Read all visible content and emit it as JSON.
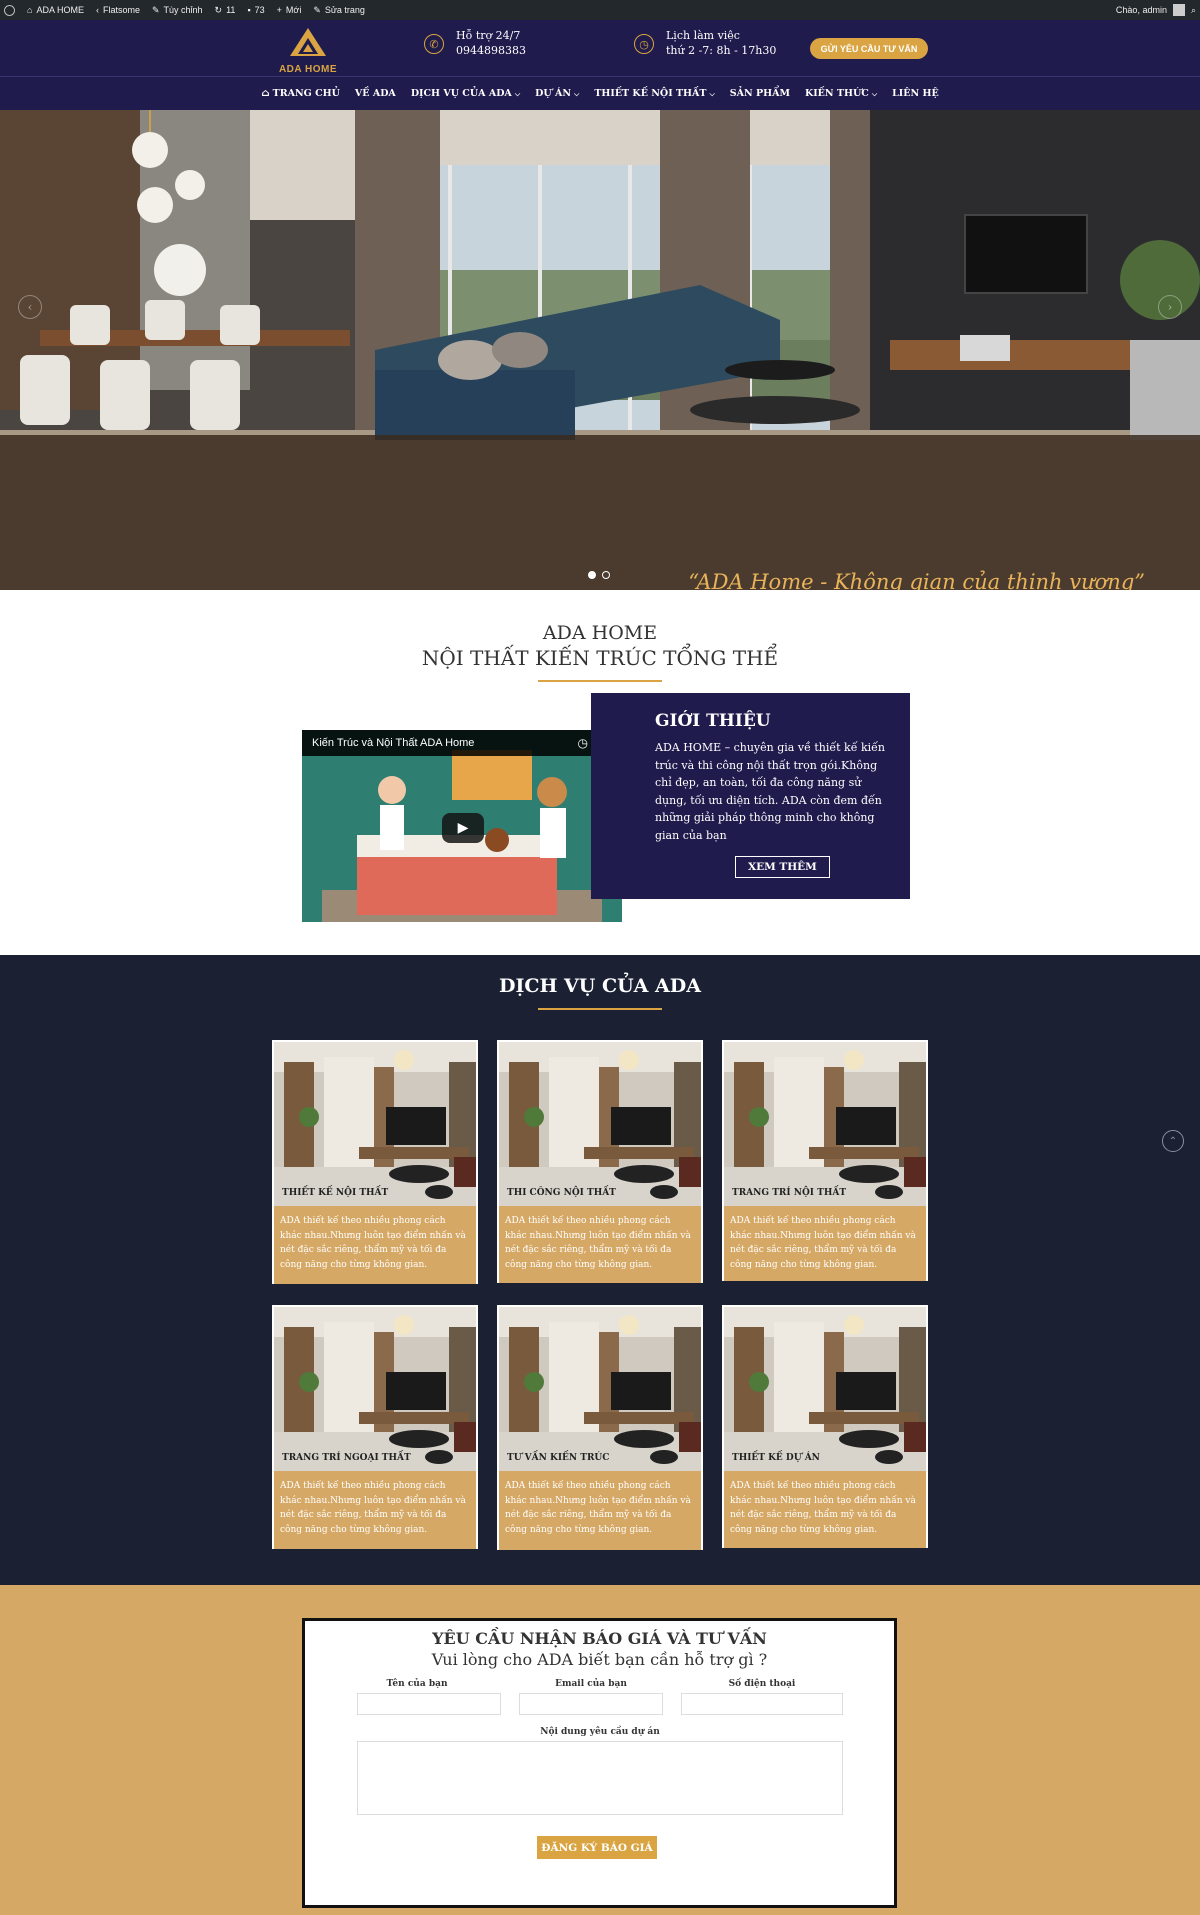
{
  "adminbar": {
    "site": "ADA HOME",
    "theme": "Flatsome",
    "customize": "Tùy chỉnh",
    "updates": "11",
    "comments": "73",
    "new": "Mới",
    "edit": "Sửa trang",
    "greeting": "Chào, admin"
  },
  "header": {
    "logo_text": "ADA HOME",
    "support_label": "Hỗ trợ 24/7",
    "support_phone": "0944898383",
    "hours_label": "Lịch làm việc",
    "hours_value": "thứ 2 -7: 8h - 17h30",
    "cta": "GỬI YÊU CẦU TƯ VẤN",
    "accent": "#d9a441",
    "bg": "#1f1b4d"
  },
  "nav": {
    "items": [
      {
        "label": "TRANG CHỦ",
        "dropdown": false
      },
      {
        "label": "VỀ ADA",
        "dropdown": false
      },
      {
        "label": "DỊCH VỤ CỦA ADA",
        "dropdown": true
      },
      {
        "label": "DỰ ÁN",
        "dropdown": true
      },
      {
        "label": "THIẾT KẾ NỘI THẤT",
        "dropdown": true
      },
      {
        "label": "SẢN PHẨM",
        "dropdown": false
      },
      {
        "label": "KIẾN THỨC",
        "dropdown": true
      },
      {
        "label": "LIÊN HỆ",
        "dropdown": false
      }
    ]
  },
  "hero": {
    "tagline": "“ADA Home -  Không gian của thịnh vượng”",
    "slides": 2,
    "active_slide": 1
  },
  "intro": {
    "title1": "ADA HOME",
    "title2": "NỘI THẤT KIẾN TRÚC TỔNG THỂ",
    "video_title": "Kiến Trúc và Nội Thất ADA Home",
    "box_heading": "GIỚI THIỆU",
    "box_text": "ADA HOME – chuyên gia về thiết kế kiến trúc và thi công nội thất trọn gói.Không chỉ đẹp, an toàn, tối đa công năng sử dụng, tối ưu diện tích. ADA còn đem đến những giải pháp thông minh cho không gian của bạn",
    "box_button": "XEM THÊM"
  },
  "services": {
    "title": "DỊCH VỤ CỦA ADA",
    "cards": [
      {
        "label": "THIẾT KẾ NỘI THẤT",
        "text": "ADA thiết kế theo nhiều phong cách khác nhau.Nhưng luôn tạo điểm nhấn và nét đặc sắc riêng, thẩm mỹ và tối đa công năng cho từng không gian."
      },
      {
        "label": "THI CÔNG NỘI THẤT",
        "text": "ADA thiết kế theo nhiều phong cách khác nhau.Nhưng luôn tạo điểm nhấn và nét đặc sắc riêng, thẩm mỹ và tối đa công năng cho từng không gian."
      },
      {
        "label": "TRANG TRÍ NỘI THẤT",
        "text": "ADA thiết kế theo nhiều phong cách khác nhau.Nhưng luôn tạo điểm nhấn và nét đặc sắc riêng, thẩm mỹ và tối đa công năng cho từng không gian."
      },
      {
        "label": "TRANG TRÍ NGOẠI THẤT",
        "text": "ADA thiết kế theo nhiều phong cách khác nhau.Nhưng luôn tạo điểm nhấn và nét đặc sắc riêng, thẩm mỹ và tối đa công năng cho từng không gian."
      },
      {
        "label": "TƯ VẤN KIẾN TRÚC",
        "text": "ADA thiết kế theo nhiều phong cách khác nhau.Nhưng luôn tạo điểm nhấn và nét đặc sắc riêng, thẩm mỹ và tối đa công năng cho từng không gian."
      },
      {
        "label": "THIẾT KẾ DỰ ÁN",
        "text": "ADA thiết kế theo nhiều phong cách khác nhau.Nhưng luôn tạo điểm nhấn và nét đặc sắc riêng, thẩm mỹ và tối đa công năng cho từng không gian."
      }
    ]
  },
  "form": {
    "title": "YÊU CẦU NHẬN BÁO GIÁ VÀ TƯ VẤN",
    "subtitle": "Vui lòng cho ADA biết bạn cần hỗ trợ gì ?",
    "name_label": "Tên của bạn",
    "email_label": "Email của bạn",
    "phone_label": "Số điện thoại",
    "message_label": "Nội dung yêu cầu dự án",
    "submit": "ĐĂNG KÝ BÁO GIÁ"
  }
}
